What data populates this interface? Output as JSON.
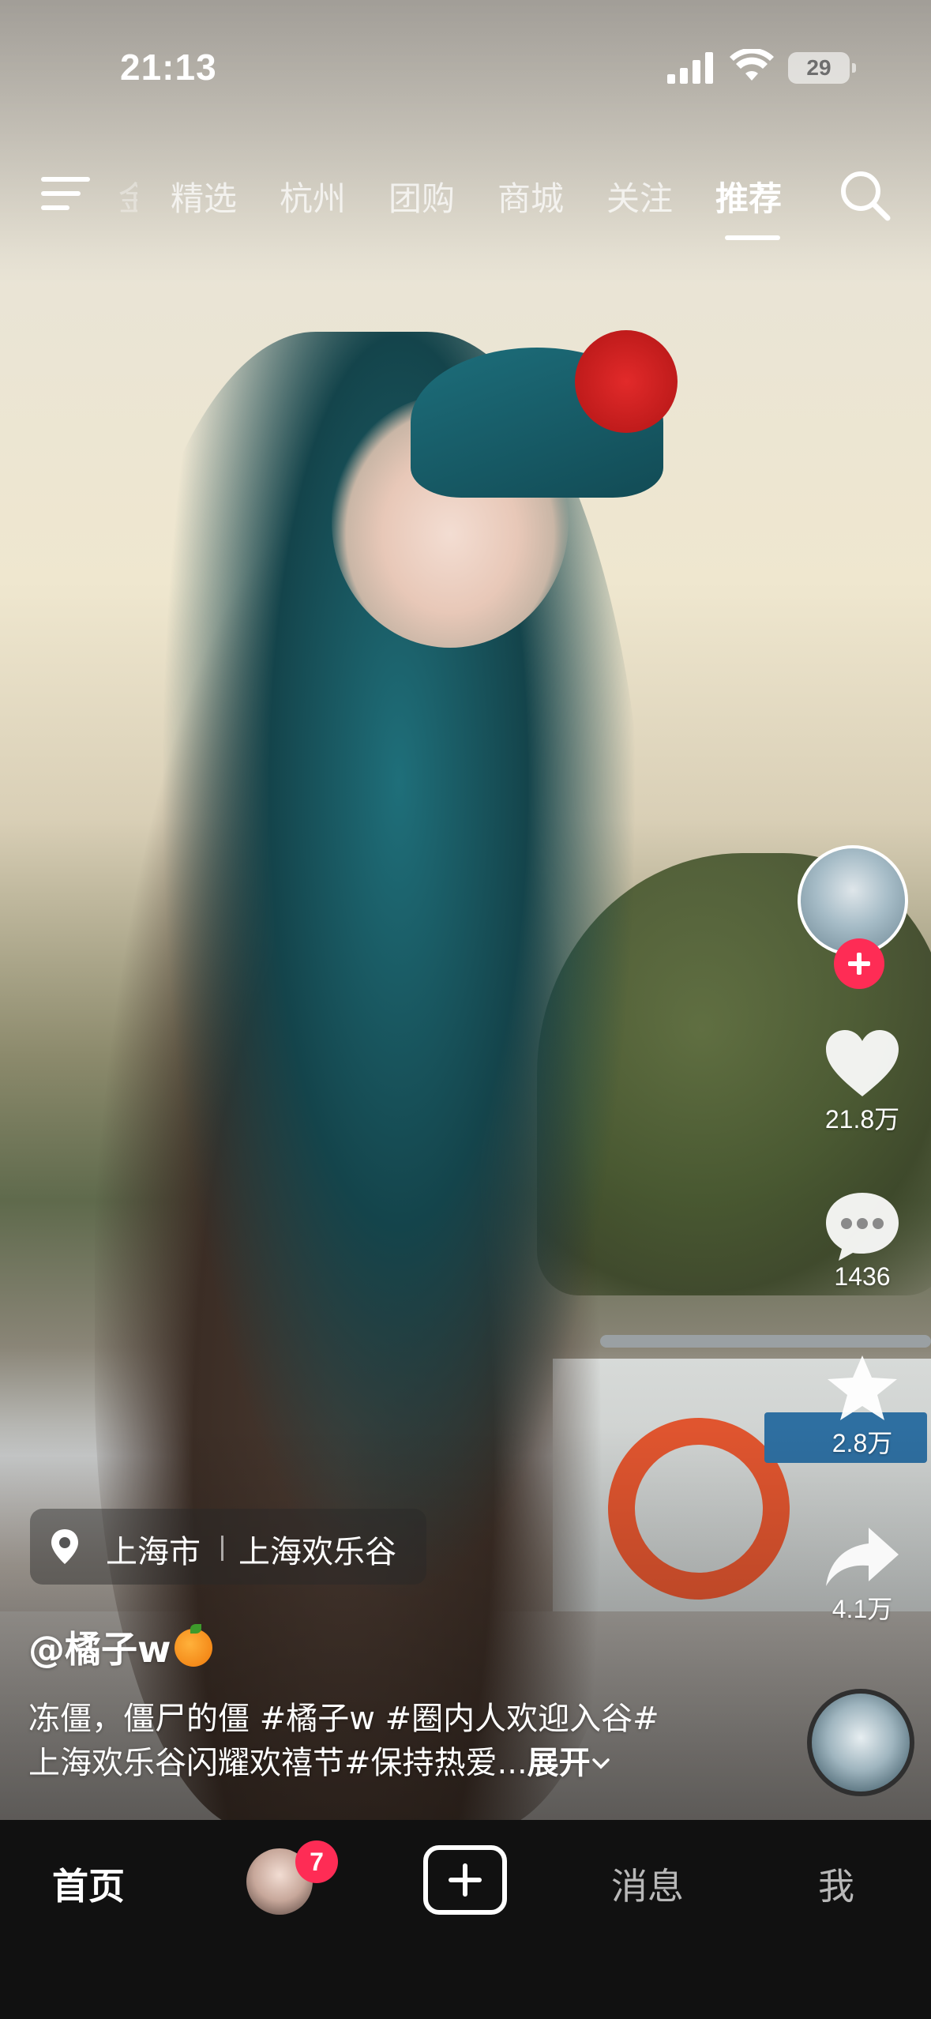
{
  "status_bar": {
    "time": "21:13",
    "battery": "29"
  },
  "top_nav": {
    "partial_tab": "金",
    "tabs": [
      "精选",
      "杭州",
      "团购",
      "商城",
      "关注",
      "推荐"
    ],
    "active_tab": "推荐"
  },
  "right_rail": {
    "likes": "21.8万",
    "comments": "1436",
    "favorites": "2.8万",
    "shares": "4.1万"
  },
  "location": {
    "city": "上海市",
    "place": "上海欢乐谷"
  },
  "video": {
    "author": "@橘子w",
    "caption_line1": "冻僵，僵尸的僵 #橘子w #圈内人欢迎入谷#",
    "caption_line2": "上海欢乐谷闪耀欢禧节#保持热爱...",
    "expand_label": "展开"
  },
  "bottom_nav": {
    "home": "首页",
    "badge_count": "7",
    "messages": "消息",
    "me": "我"
  },
  "colors": {
    "accent": "#fe2c55",
    "nav_bg": "#111111"
  }
}
